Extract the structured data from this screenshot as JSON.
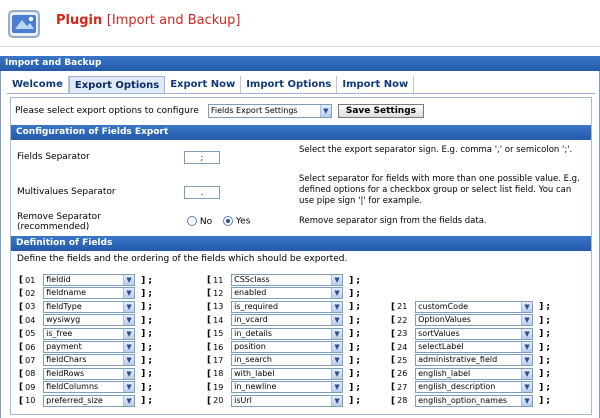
{
  "header": {
    "title": "Plugin",
    "subtitle": "[Import and Backup]"
  },
  "section": {
    "title": "Import and Backup"
  },
  "tabs": [
    {
      "label": "Welcome",
      "active": false
    },
    {
      "label": "Export Options",
      "active": true
    },
    {
      "label": "Export Now",
      "active": false
    },
    {
      "label": "Import Options",
      "active": false
    },
    {
      "label": "Import Now",
      "active": false
    }
  ],
  "selector": {
    "label": "Please select export options to configure",
    "value": "Fields Export Settings",
    "save_label": "Save Settings"
  },
  "config": {
    "title": "Configuration of Fields Export",
    "rows": [
      {
        "label": "Fields Separator",
        "value": ";",
        "desc": "Select the export separator sign. E.g. comma ',' or semicolon ';'."
      },
      {
        "label": "Multivalues Separator",
        "value": ".",
        "desc": "Select separator for fields with more than one possible value. E.g. defined options for a checkbox group or select list field. You can use pipe sign '|' for example."
      },
      {
        "label": "Remove Separator (recommended)",
        "no_label": "No",
        "yes_label": "Yes",
        "selected": "Yes",
        "desc": "Remove separator sign from the fields data."
      }
    ]
  },
  "definition": {
    "title": "Definition of Fields",
    "desc": "Define the fields and the ordering of the fields which should be exported.",
    "fields": [
      {
        "num": "01",
        "value": "fieldid"
      },
      {
        "num": "02",
        "value": "fieldname"
      },
      {
        "num": "03",
        "value": "fieldType"
      },
      {
        "num": "04",
        "value": "wysiwyg"
      },
      {
        "num": "05",
        "value": "is_free"
      },
      {
        "num": "06",
        "value": "payment"
      },
      {
        "num": "07",
        "value": "fieldChars"
      },
      {
        "num": "08",
        "value": "fieldRows"
      },
      {
        "num": "09",
        "value": "fieldColumns"
      },
      {
        "num": "10",
        "value": "preferred_size"
      },
      {
        "num": "11",
        "value": "CSSclass"
      },
      {
        "num": "12",
        "value": "enabled"
      },
      {
        "num": "13",
        "value": "is_required"
      },
      {
        "num": "14",
        "value": "in_vcard"
      },
      {
        "num": "15",
        "value": "in_details"
      },
      {
        "num": "16",
        "value": "position"
      },
      {
        "num": "17",
        "value": "in_search"
      },
      {
        "num": "18",
        "value": "with_label"
      },
      {
        "num": "19",
        "value": "in_newline"
      },
      {
        "num": "20",
        "value": "isUrl"
      },
      {
        "num": "21",
        "value": "customCode"
      },
      {
        "num": "22",
        "value": "OptionValues"
      },
      {
        "num": "23",
        "value": "sortValues"
      },
      {
        "num": "24",
        "value": "selectLabel"
      },
      {
        "num": "25",
        "value": "administrative_field"
      },
      {
        "num": "26",
        "value": "english_label"
      },
      {
        "num": "27",
        "value": "english_description"
      },
      {
        "num": "28",
        "value": "english_option_names"
      }
    ],
    "open_bracket": "[",
    "close_bracket": "] ;"
  },
  "colors": {
    "title_red": "#d6261c",
    "bar_blue": "#2f68b8",
    "tab_text": "#123a7a"
  }
}
